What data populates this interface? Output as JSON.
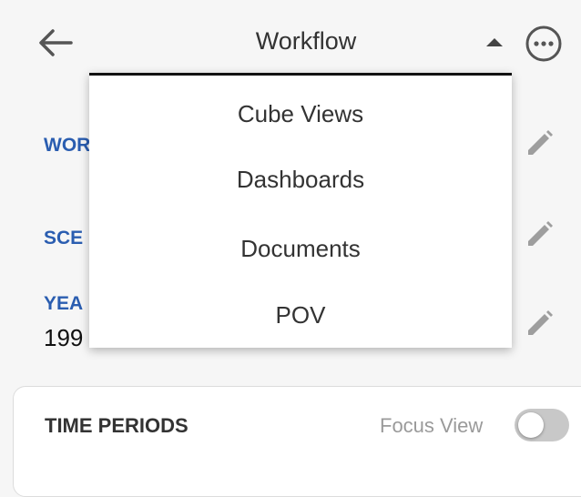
{
  "header": {
    "title": "Workflow",
    "back_icon": "arrow-left-icon",
    "collapse_icon": "caret-up-icon",
    "more_icon": "more-horizontal-circle-icon"
  },
  "fields": [
    {
      "label": "WOR",
      "edit_icon": "pencil-icon"
    },
    {
      "label": "SCE",
      "edit_icon": "pencil-icon"
    },
    {
      "label": "YEA",
      "value": "199",
      "edit_icon": "pencil-icon"
    }
  ],
  "dropdown_menu": {
    "items": [
      {
        "label": "Cube Views"
      },
      {
        "label": "Dashboards"
      },
      {
        "label": "Documents"
      },
      {
        "label": "POV"
      }
    ]
  },
  "time_periods": {
    "title": "TIME PERIODS",
    "focus_view_label": "Focus View",
    "focus_view_on": false
  },
  "colors": {
    "label_blue": "#2a5db0",
    "icon_gray": "#9e9e9e",
    "toggle_off": "#c8c8c8",
    "background": "#f6f6f6"
  }
}
